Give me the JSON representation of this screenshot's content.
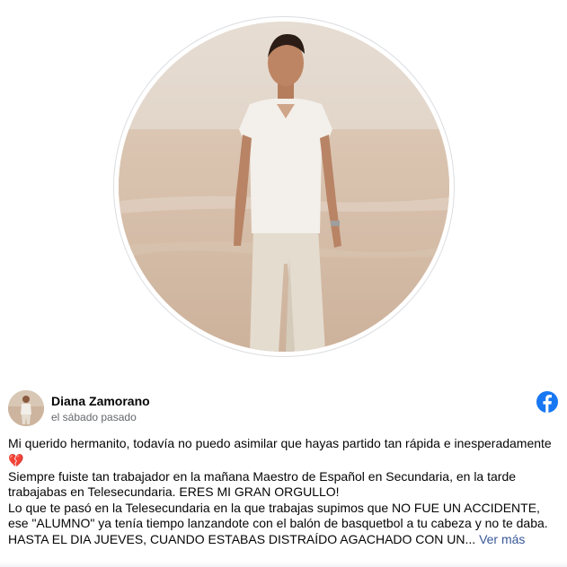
{
  "post": {
    "author": "Diana Zamorano",
    "time": "el sábado pasado",
    "lines": [
      "Mi querido hermanito, todavía no puedo asimilar que hayas partido tan rápida e inesperadamente",
      "Siempre fuiste tan trabajador en la mañana Maestro de Español en Secundaria, en la tarde",
      "trabajabas en Telesecundaria. ERES MI GRAN ORGULLO!",
      "Lo que te pasó en la Telesecundaria en la que trabajas supimos que NO FUE UN ACCIDENTE,",
      "ese \"ALUMNO\" ya tenía tiempo lanzandote con el balón de basquetbol a tu cabeza y no te daba.",
      "HASTA EL DIA JUEVES, CUANDO ESTABAS DISTRAÍDO AGACHADO CON UN..."
    ],
    "see_more": "Ver más",
    "heart_emoji": "💔"
  },
  "icons": {
    "platform": "facebook-icon",
    "emoji": "broken-heart-icon"
  },
  "colors": {
    "facebook_blue": "#1877f2",
    "link_blue": "#385898",
    "secondary_text": "#65676b"
  }
}
